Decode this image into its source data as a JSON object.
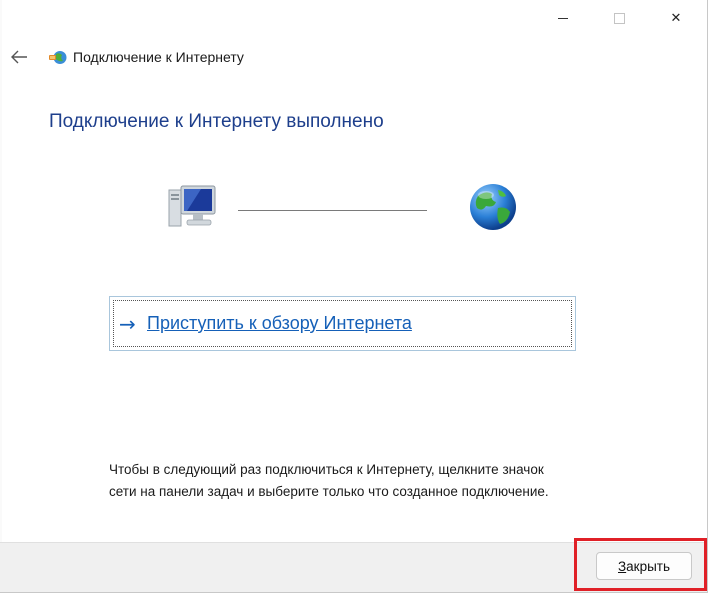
{
  "window": {
    "minimize_icon": "minimize-icon",
    "maximize_icon": "maximize-icon",
    "close_icon": "close-icon",
    "close_glyph": "✕"
  },
  "header": {
    "back_icon": "back-arrow-icon",
    "app_icon": "network-connection-icon",
    "title": "Подключение к Интернету"
  },
  "main": {
    "heading": "Подключение к Интернету выполнено",
    "computer_icon": "computer-icon",
    "globe_icon": "globe-icon",
    "browse_arrow": "→",
    "browse_link": "Приступить к обзору Интернета",
    "hint_line1": "Чтобы в следующий раз подключиться к Интернету, щелкните значок",
    "hint_line2": "сети на панели задач и выберите только что созданное подключение."
  },
  "footer": {
    "close_button_first": "З",
    "close_button_rest": "акрыть"
  },
  "colors": {
    "heading": "#1e3f8c",
    "link": "#1560b8",
    "highlight": "#e02027"
  }
}
